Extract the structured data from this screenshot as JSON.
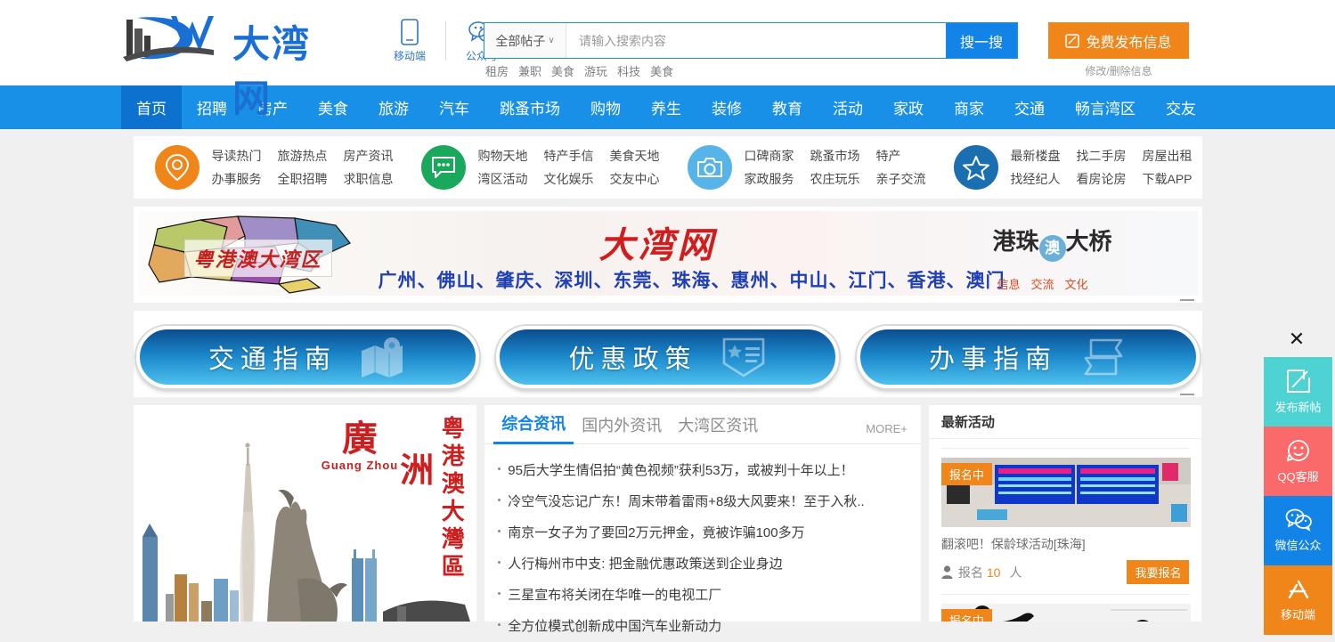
{
  "site": {
    "logo_text": "大湾网",
    "logo_mark": "DW"
  },
  "header": {
    "mobile_label": "移动端",
    "official_label": "公众号",
    "search": {
      "category": "全部帖子",
      "placeholder": "请输入搜索内容",
      "button": "搜一搜",
      "hot_words": [
        "租房",
        "兼职",
        "美食",
        "游玩",
        "科技",
        "美食"
      ]
    },
    "publish": {
      "label": "免费发布信息",
      "sub": "修改/删除信息"
    }
  },
  "nav": {
    "items": [
      {
        "label": "首页",
        "active": true
      },
      {
        "label": "招聘",
        "active": false
      },
      {
        "label": "房产",
        "active": false
      },
      {
        "label": "美食",
        "active": false
      },
      {
        "label": "旅游",
        "active": false
      },
      {
        "label": "汽车",
        "active": false
      },
      {
        "label": "跳蚤市场",
        "active": false
      },
      {
        "label": "购物",
        "active": false
      },
      {
        "label": "养生",
        "active": false
      },
      {
        "label": "装修",
        "active": false
      },
      {
        "label": "教育",
        "active": false
      },
      {
        "label": "活动",
        "active": false
      },
      {
        "label": "家政",
        "active": false
      },
      {
        "label": "商家",
        "active": false
      },
      {
        "label": "交通",
        "active": false
      },
      {
        "label": "畅言湾区",
        "active": false
      },
      {
        "label": "交友",
        "active": false
      }
    ]
  },
  "quick_links": {
    "groups": [
      {
        "icon": "location-pin-icon",
        "color": "#f08519",
        "links": [
          "导读热门",
          "旅游热点",
          "房产资讯",
          "办事服务",
          "全职招聘",
          "求职信息"
        ]
      },
      {
        "icon": "chat-bubble-icon",
        "color": "#1aa85c",
        "links": [
          "购物天地",
          "特产手信",
          "美食天地",
          "湾区活动",
          "文化娱乐",
          "交友中心"
        ]
      },
      {
        "icon": "camera-icon",
        "color": "#56b4e8",
        "links": [
          "口碑商家",
          "跳蚤市场",
          "特产",
          "家政服务",
          "农庄玩乐",
          "亲子交流"
        ]
      },
      {
        "icon": "star-icon",
        "color": "#1a6fb0",
        "links": [
          "最新楼盘",
          "找二手房",
          "房屋出租",
          "找经纪人",
          "看房论房",
          "下载APP"
        ]
      }
    ]
  },
  "banner": {
    "seal": "粤港澳大湾区",
    "title": "大湾网",
    "cities": "广州、佛山、肇庆、深圳、东莞、珠海、惠州、中山、江门、香港、澳门",
    "bridge_pre": "港珠",
    "bridge_dot": "澳",
    "bridge_post": "大桥",
    "tags": [
      "信息",
      "交流",
      "文化"
    ]
  },
  "guide_buttons": [
    {
      "label": "交通指南",
      "icon": "map-fold-icon"
    },
    {
      "label": "优惠政策",
      "icon": "badge-shield-icon"
    },
    {
      "label": "办事指南",
      "icon": "signpost-icon"
    }
  ],
  "city_card": {
    "cn": "廣",
    "pinyin": "Guang Zhou",
    "zhou": "洲",
    "vertical": "粤港澳大灣區"
  },
  "news": {
    "tabs": [
      {
        "label": "综合资讯",
        "active": true
      },
      {
        "label": "国内外资讯",
        "active": false
      },
      {
        "label": "大湾区资讯",
        "active": false
      }
    ],
    "more": "MORE+",
    "items": [
      "95后大学生情侣拍“黄色视频”获利53万，或被判十年以上！",
      "冷空气没忘记广东！周末带着雷雨+8级大风要来！至于入秋..",
      "南京一女子为了要回2万元押金，竟被诈骗100多万",
      "人行梅州市中支: 把金融优惠政策送到企业身边",
      "三星宣布将关闭在华唯一的电视工厂",
      "全方位模式创新成中国汽车业新动力"
    ]
  },
  "activities": {
    "title": "最新活动",
    "items": [
      {
        "badge": "报名中",
        "title": "翻滚吧！保龄球活动[珠海]",
        "signup_label": "报名",
        "count": "10",
        "count_unit": "人",
        "join_label": "我要报名"
      },
      {
        "badge": "报名中"
      }
    ]
  },
  "sidebar": {
    "close": "✕",
    "items": [
      {
        "label": "发布新帖",
        "icon": "compose-icon",
        "color": "#4fd2d2"
      },
      {
        "label": "QQ客服",
        "icon": "smiley-icon",
        "color": "#fa6a6a"
      },
      {
        "label": "微信公众",
        "icon": "wechat-icon",
        "color": "#1284e8"
      },
      {
        "label": "移动端",
        "icon": "app-store-icon",
        "color": "#f08519"
      }
    ]
  },
  "colors": {
    "nav_blue": "#1890e8",
    "nav_active": "#0d72cf",
    "accent_orange": "#f08519",
    "link_blue": "#1284e8",
    "page_bg": "#f0f0f0"
  }
}
